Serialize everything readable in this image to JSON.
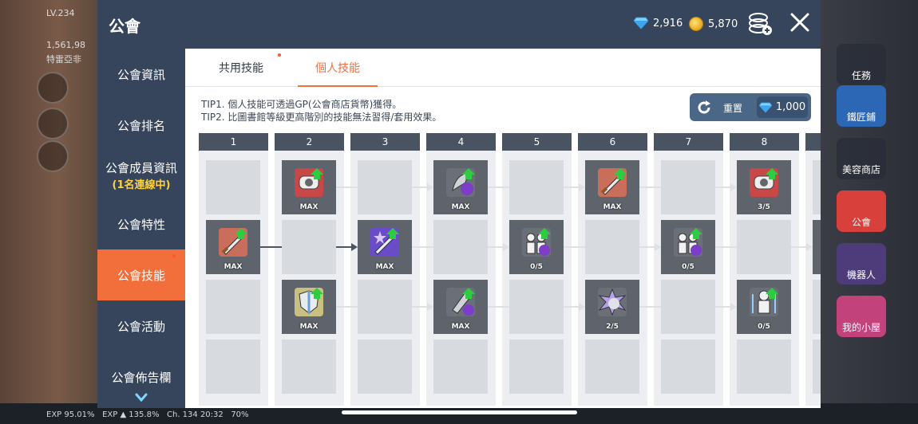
{
  "colors": {
    "titlebar": "#36455b",
    "accent": "#f26f3b",
    "reset_button": "#4a6788"
  },
  "background_hud": {
    "level": "LV.234",
    "cp": "1,561,98",
    "location": "特雷亞非",
    "exp_text": "EXP 95.01%",
    "exp_bar_text": "EXP ▲ 135.8%",
    "channel_time": "Ch. 134 20:32",
    "battery": "70%"
  },
  "right_menu": [
    {
      "label": "任務",
      "icon": "quest-icon"
    },
    {
      "label": "鐵匠鋪",
      "icon": "anvil-icon"
    },
    {
      "label": "美容商店",
      "icon": "beauty-shop-icon"
    },
    {
      "label": "公會",
      "icon": "guild-icon"
    },
    {
      "label": "機器人",
      "icon": "robot-icon"
    },
    {
      "label": "我的小屋",
      "icon": "house-icon"
    }
  ],
  "window": {
    "title": "公會",
    "gems": "2,916",
    "coins": "5,870"
  },
  "sidebar": {
    "items": [
      {
        "label": "公會資訊",
        "sub": ""
      },
      {
        "label": "公會排名",
        "sub": ""
      },
      {
        "label": "公會成員資訊",
        "sub": "(1名連線中)"
      },
      {
        "label": "公會特性",
        "sub": ""
      },
      {
        "label": "公會技能",
        "sub": ""
      },
      {
        "label": "公會活動",
        "sub": ""
      },
      {
        "label": "公會佈告欄",
        "sub": ""
      }
    ]
  },
  "tabs": [
    {
      "label": "共用技能"
    },
    {
      "label": "個人技能"
    }
  ],
  "tips": {
    "tip1": "TIP1. 個人技能可透過GP(公會商店貨幣)獲得。",
    "tip2": "TIP2. 比圖書館等級更高階別的技能無法習得/套用效果。"
  },
  "reset": {
    "label": "重置",
    "cost": "1,000"
  },
  "skill_tree": {
    "columns": [
      "1",
      "2",
      "3",
      "4",
      "5",
      "6",
      "7",
      "8",
      ""
    ],
    "rows": [
      [
        "",
        "MAX",
        "",
        "MAX",
        "",
        "MAX",
        "",
        "3/5",
        ""
      ],
      [
        "MAX",
        "",
        "MAX",
        "",
        "0/5",
        "",
        "0/5",
        "",
        ""
      ],
      [
        "",
        "MAX",
        "",
        "MAX",
        "",
        "2/5",
        "",
        "0/5",
        ""
      ],
      [
        "",
        "",
        "",
        "",
        "",
        "",
        "",
        "",
        ""
      ]
    ],
    "skill_icons": [
      [
        "",
        "shield-armor-icon",
        "",
        "claw-icon",
        "",
        "sword-icon",
        "",
        "shield-armor-icon",
        ""
      ],
      [
        "sword-icon",
        "",
        "sword-star-icon",
        "",
        "party-icon",
        "",
        "party-icon",
        "",
        "sword-icon"
      ],
      [
        "",
        "shield-icon",
        "",
        "gauntlet-icon",
        "",
        "explosion-icon",
        "",
        "figure-icon",
        ""
      ],
      [
        "",
        "",
        "",
        "",
        "",
        "",
        "",
        "",
        ""
      ]
    ]
  }
}
